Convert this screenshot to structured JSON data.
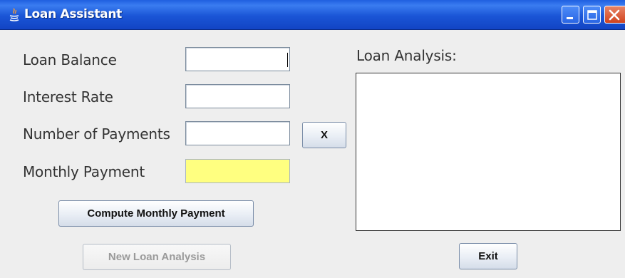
{
  "window": {
    "title": "Loan Assistant",
    "title_icon": "java-icon",
    "controls": [
      "minimize-icon",
      "maximize-icon",
      "close-icon"
    ]
  },
  "form": {
    "loan_balance_label": "Loan Balance",
    "interest_rate_label": "Interest Rate",
    "number_of_payments_label": "Number of Payments",
    "monthly_payment_label": "Monthly Payment",
    "loan_balance_value": "",
    "interest_rate_value": "",
    "number_of_payments_value": "",
    "monthly_payment_value": "",
    "monthly_payment_highlight_color": "#ffff80",
    "toggle_button_label": "X",
    "compute_button_label": "Compute Monthly Payment",
    "new_analysis_button_label": "New Loan Analysis"
  },
  "analysis": {
    "label": "Loan Analysis:",
    "content": "",
    "exit_button_label": "Exit"
  },
  "colors": {
    "titlebar": "#1a55d6",
    "window_bg": "#eeeeee",
    "close_button": "#d0431e"
  }
}
